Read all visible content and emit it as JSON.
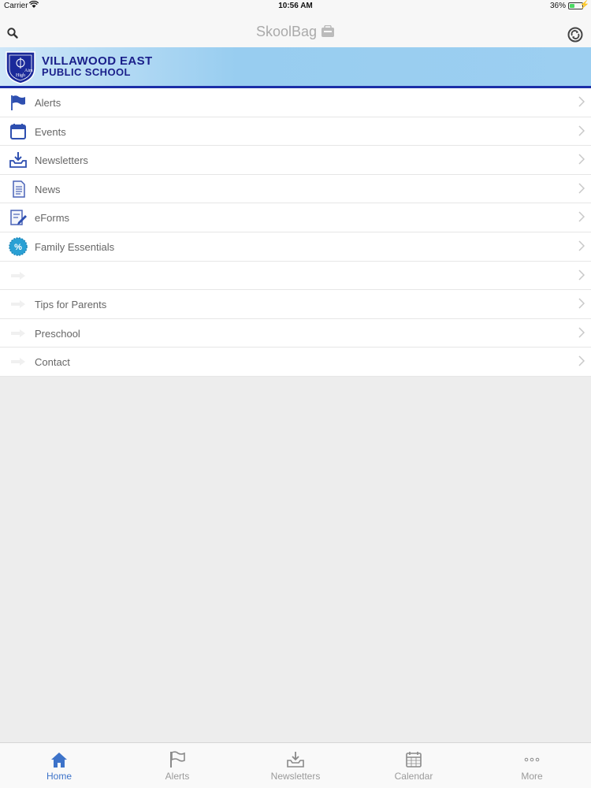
{
  "status_bar": {
    "carrier": "Carrier",
    "time": "10:56 AM",
    "battery": "36%",
    "battery_level": 0.36
  },
  "nav_bar": {
    "brand": "SkoolBag",
    "search_icon": "search-icon",
    "sync_icon": "sync-icon"
  },
  "banner": {
    "line1": "VILLAWOOD EAST",
    "line2": "PUBLIC SCHOOL",
    "crest_text_top": "VILLAWOOD EAST",
    "crest_text_a": "Aim",
    "crest_text_b": "High"
  },
  "menu": {
    "items": [
      {
        "label": "Alerts",
        "icon": "flag-icon"
      },
      {
        "label": "Events",
        "icon": "calendar-icon"
      },
      {
        "label": "Newsletters",
        "icon": "inbox-download-icon"
      },
      {
        "label": "News",
        "icon": "document-icon"
      },
      {
        "label": "eForms",
        "icon": "form-edit-icon"
      },
      {
        "label": "Family Essentials",
        "icon": "discount-badge-icon"
      },
      {
        "label": "",
        "icon": "arrow-right-icon"
      },
      {
        "label": "Tips for Parents",
        "icon": "arrow-right-icon"
      },
      {
        "label": "Preschool",
        "icon": "arrow-right-icon"
      },
      {
        "label": "Contact",
        "icon": "arrow-right-icon"
      }
    ]
  },
  "tab_bar": {
    "tabs": [
      {
        "label": "Home",
        "icon": "home-icon",
        "active": true
      },
      {
        "label": "Alerts",
        "icon": "flag-icon",
        "active": false
      },
      {
        "label": "Newsletters",
        "icon": "inbox-download-icon",
        "active": false
      },
      {
        "label": "Calendar",
        "icon": "calendar-icon",
        "active": false
      },
      {
        "label": "More",
        "icon": "more-icon",
        "active": false
      }
    ]
  },
  "colors": {
    "accent": "#3d73c9",
    "school_blue": "#1a1f8a",
    "banner_border": "#1b2ea8"
  }
}
